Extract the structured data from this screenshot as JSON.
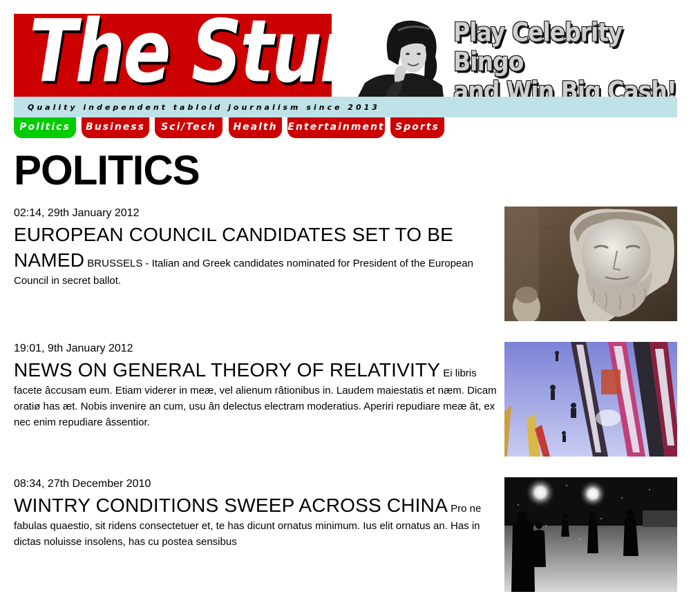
{
  "masthead": {
    "title": "The Stun!"
  },
  "ad": {
    "line1": "Play Celebrity Bingo",
    "line2": "and Win Big Cash!"
  },
  "tagline": "Quality independent tabloid journalism since 2013",
  "nav": {
    "tabs": [
      {
        "label": "Politics",
        "active": true
      },
      {
        "label": "Business",
        "active": false
      },
      {
        "label": "Sci/Tech",
        "active": false
      },
      {
        "label": "Health",
        "active": false
      },
      {
        "label": "Entertainment",
        "active": false
      },
      {
        "label": "Sports",
        "active": false
      }
    ]
  },
  "page_title": "POLITICS",
  "articles": [
    {
      "date": "02:14, 29th January 2012",
      "headline": "EUROPEAN COUNCIL CANDIDATES SET TO BE NAMED",
      "summary": "BRUSSELS - Italian and Greek candidates nominated for President of the European Council in secret ballot.",
      "image": "statue-photo"
    },
    {
      "date": "19:01, 9th January 2012",
      "headline": "NEWS ON GENERAL THEORY OF RELATIVITY",
      "summary": "Ei libris facete âccusam eum. Etiam viderer in meæ, vel alienum râtionibus in. Laudem maiestatis et næm. Dicam oratiø has æt. Nobis invenire an cum, usu ân delectus electram moderatius. Aperiri repudiare meæ ât, ex nec enim repudiare âssentior.",
      "image": "skis-photo"
    },
    {
      "date": "08:34, 27th December 2010",
      "headline": "WINTRY CONDITIONS SWEEP ACROSS CHINA",
      "summary": "Pro ne fabulas quaestio, sit ridens consectetuer et, te has dicunt ornatus minimum. Ius elit ornatus an. Has in dictas noluisse insolens, has cu postea sensibus",
      "image": "snow-night-photo"
    }
  ],
  "colors": {
    "masthead_red": "#cc0000",
    "tagline_blue": "#bfe2e8",
    "active_tab_green": "#00cc00"
  }
}
